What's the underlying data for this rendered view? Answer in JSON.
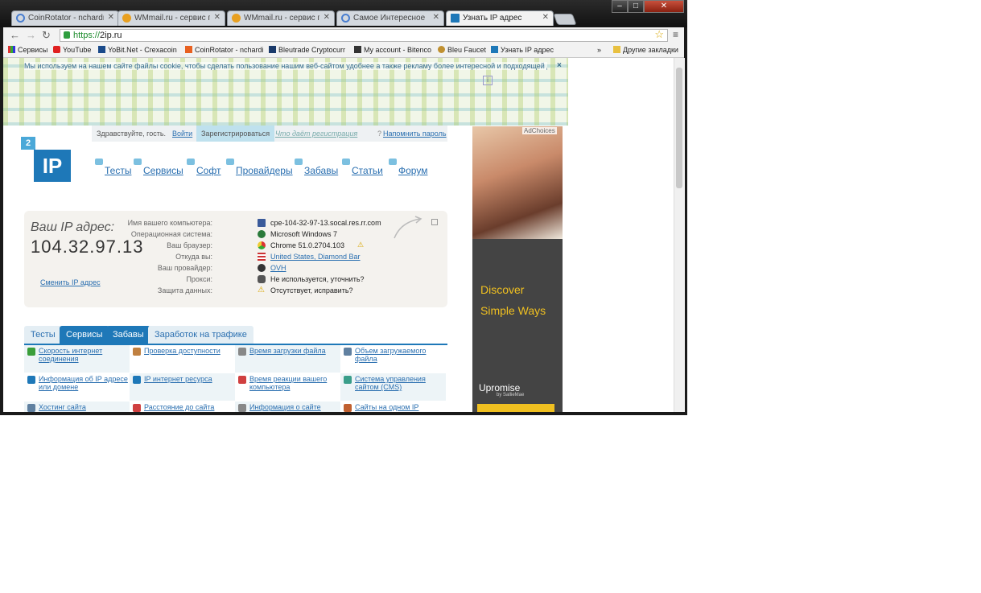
{
  "browser": {
    "tabs": [
      {
        "title": "CoinRotator - nchardmor",
        "active": false,
        "favicon_color": "#4a7fd0"
      },
      {
        "title": "WMmail.ru - сервис почт",
        "active": false,
        "favicon_color": "#e8a020"
      },
      {
        "title": "WMmail.ru - сервис почт",
        "active": false,
        "favicon_color": "#e8a020"
      },
      {
        "title": "Самое Интересное",
        "active": false,
        "favicon_color": "#4a7fd0"
      },
      {
        "title": "Узнать IP адрес",
        "active": true,
        "favicon_color": "#1e78b8"
      }
    ],
    "window_controls": {
      "minimize": "–",
      "maximize": "□",
      "close": "✕"
    },
    "url_scheme": "https://",
    "url_host": "2ip.ru",
    "bookmarks": [
      {
        "label": "Сервисы",
        "icon": "apps-icon"
      },
      {
        "label": "YouTube",
        "icon": "youtube-icon"
      },
      {
        "label": "YoBit.Net - Crexacoin",
        "icon": "yobit-icon"
      },
      {
        "label": "CoinRotator - nchardi",
        "icon": "coinrotator-icon"
      },
      {
        "label": "Bleutrade Cryptocurr",
        "icon": "bleutrade-icon"
      },
      {
        "label": "My account - Bitenco",
        "icon": "account-icon"
      },
      {
        "label": "Bleu Faucet",
        "icon": "faucet-icon"
      },
      {
        "label": "Узнать IP адрес",
        "icon": "ip-icon"
      }
    ],
    "bookmarks_overflow": "»",
    "other_bookmarks": "Другие закладки"
  },
  "page": {
    "cookie_text": "Мы используем на нашем сайте файлы cookie, чтобы сделать пользование нашим веб-сайтом удобнее а также рекламу более интересной и подходящей для вас.",
    "close": "×",
    "userbar": {
      "greeting": "Здравствуйте, гость.",
      "login": "Войти",
      "register": "Зарегистрироваться",
      "why": "Что даёт регистрация",
      "bookmark": "Напомнить пароль",
      "question_mark": "?"
    },
    "logo": {
      "top": "2",
      "main": "IP"
    },
    "nav": [
      "Тесты",
      "Сервисы",
      "Софт",
      "Провайдеры",
      "Забавы",
      "Статьи",
      "Форум"
    ],
    "ip_label": "Ваш IP адрес:",
    "ip_value": "104.32.97.13",
    "change_ip": "Сменить IP адрес",
    "info": [
      {
        "label": "Имя вашего компьютера:",
        "value": "cpe-104-32-97-13.socal.res.rr.com",
        "icon": "computer-icon",
        "link": false
      },
      {
        "label": "Операционная система:",
        "value": "Microsoft Windows 7",
        "icon": "windows-icon",
        "link": false
      },
      {
        "label": "Ваш браузер:",
        "value": "Chrome 51.0.2704.103",
        "icon": "chrome-icon",
        "link": false
      },
      {
        "label": "Откуда вы:",
        "value": "United States, Diamond Bar",
        "icon": "flag-icon",
        "link": true
      },
      {
        "label": "Ваш провайдер:",
        "value": "OVH",
        "icon": "provider-icon",
        "link": true
      },
      {
        "label": "Прокси:",
        "value": "Не используется, уточнить?",
        "icon": "proxy-icon",
        "link": false
      },
      {
        "label": "Защита данных:",
        "value": "Отсутствует, исправить?",
        "icon": "warning-icon",
        "link": false
      }
    ],
    "tabs": [
      {
        "label": "Тесты",
        "active": false
      },
      {
        "label": "Сервисы",
        "active": true
      },
      {
        "label": "Забавы",
        "active": true
      },
      {
        "label": "Заработок на трафике",
        "active": false
      }
    ],
    "services": [
      {
        "label": "Скорость интернет соединения",
        "icon_color": "#3a9e3a"
      },
      {
        "label": "Проверка доступности",
        "icon_color": "#c08040"
      },
      {
        "label": "Время загрузки файла",
        "icon_color": "#888888"
      },
      {
        "label": "Объем загружаемого файла",
        "icon_color": "#6080a0"
      },
      {
        "label": "Информация об IP адресе или домене",
        "icon_color": "#1e78b8"
      },
      {
        "label": "IP интернет ресурса",
        "icon_color": "#1e78b8"
      },
      {
        "label": "Время реакции вашего компьютера",
        "icon_color": "#d04040"
      },
      {
        "label": "Система управления сайтом (CMS)",
        "icon_color": "#3a9e8a"
      },
      {
        "label": "Хостинг сайта",
        "icon_color": "#6080a0"
      },
      {
        "label": "Расстояние до сайта",
        "icon_color": "#d04040"
      },
      {
        "label": "Информация о сайте",
        "icon_color": "#888888"
      },
      {
        "label": "Сайты на одном IP",
        "icon_color": "#c06030"
      }
    ],
    "ad": {
      "choices": "AdChoices",
      "line1": "Discover",
      "line2": "Simple Ways",
      "brand": "Upromise",
      "brand_sub": "by SallieMae"
    }
  }
}
